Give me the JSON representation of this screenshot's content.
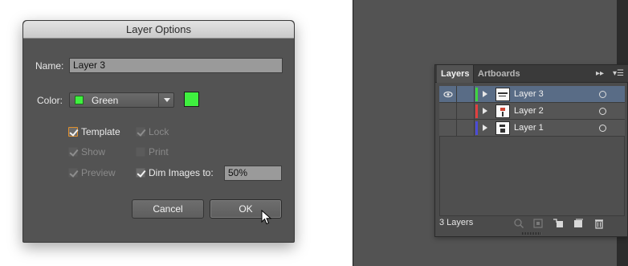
{
  "dialog": {
    "title": "Layer Options",
    "name_label": "Name:",
    "name_value": "Layer 3",
    "color_label": "Color:",
    "color_value": "Green",
    "color_hex": "#3ff03f",
    "checkboxes": {
      "template": {
        "label": "Template",
        "checked": true,
        "enabled": true
      },
      "lock": {
        "label": "Lock",
        "checked": true,
        "enabled": false
      },
      "show": {
        "label": "Show",
        "checked": true,
        "enabled": false
      },
      "print": {
        "label": "Print",
        "checked": false,
        "enabled": false
      },
      "preview": {
        "label": "Preview",
        "checked": true,
        "enabled": false
      },
      "dim_images": {
        "label": "Dim Images to:",
        "checked": true,
        "enabled": true
      }
    },
    "dim_value": "50%",
    "cancel_label": "Cancel",
    "ok_label": "OK"
  },
  "layers_panel": {
    "tabs": [
      {
        "label": "Layers"
      },
      {
        "label": "Artboards"
      }
    ],
    "layers": [
      {
        "name": "Layer 3",
        "color": "#3fd43f",
        "selected": true,
        "visible": true
      },
      {
        "name": "Layer 2",
        "color": "#e04040",
        "selected": false,
        "visible": false
      },
      {
        "name": "Layer 1",
        "color": "#4b4bd6",
        "selected": false,
        "visible": false
      }
    ],
    "count_text": "3 Layers",
    "footer_icons": [
      "locate-object-icon",
      "make-clipping-mask-icon",
      "new-sublayer-icon",
      "new-layer-icon",
      "trash-icon"
    ]
  }
}
